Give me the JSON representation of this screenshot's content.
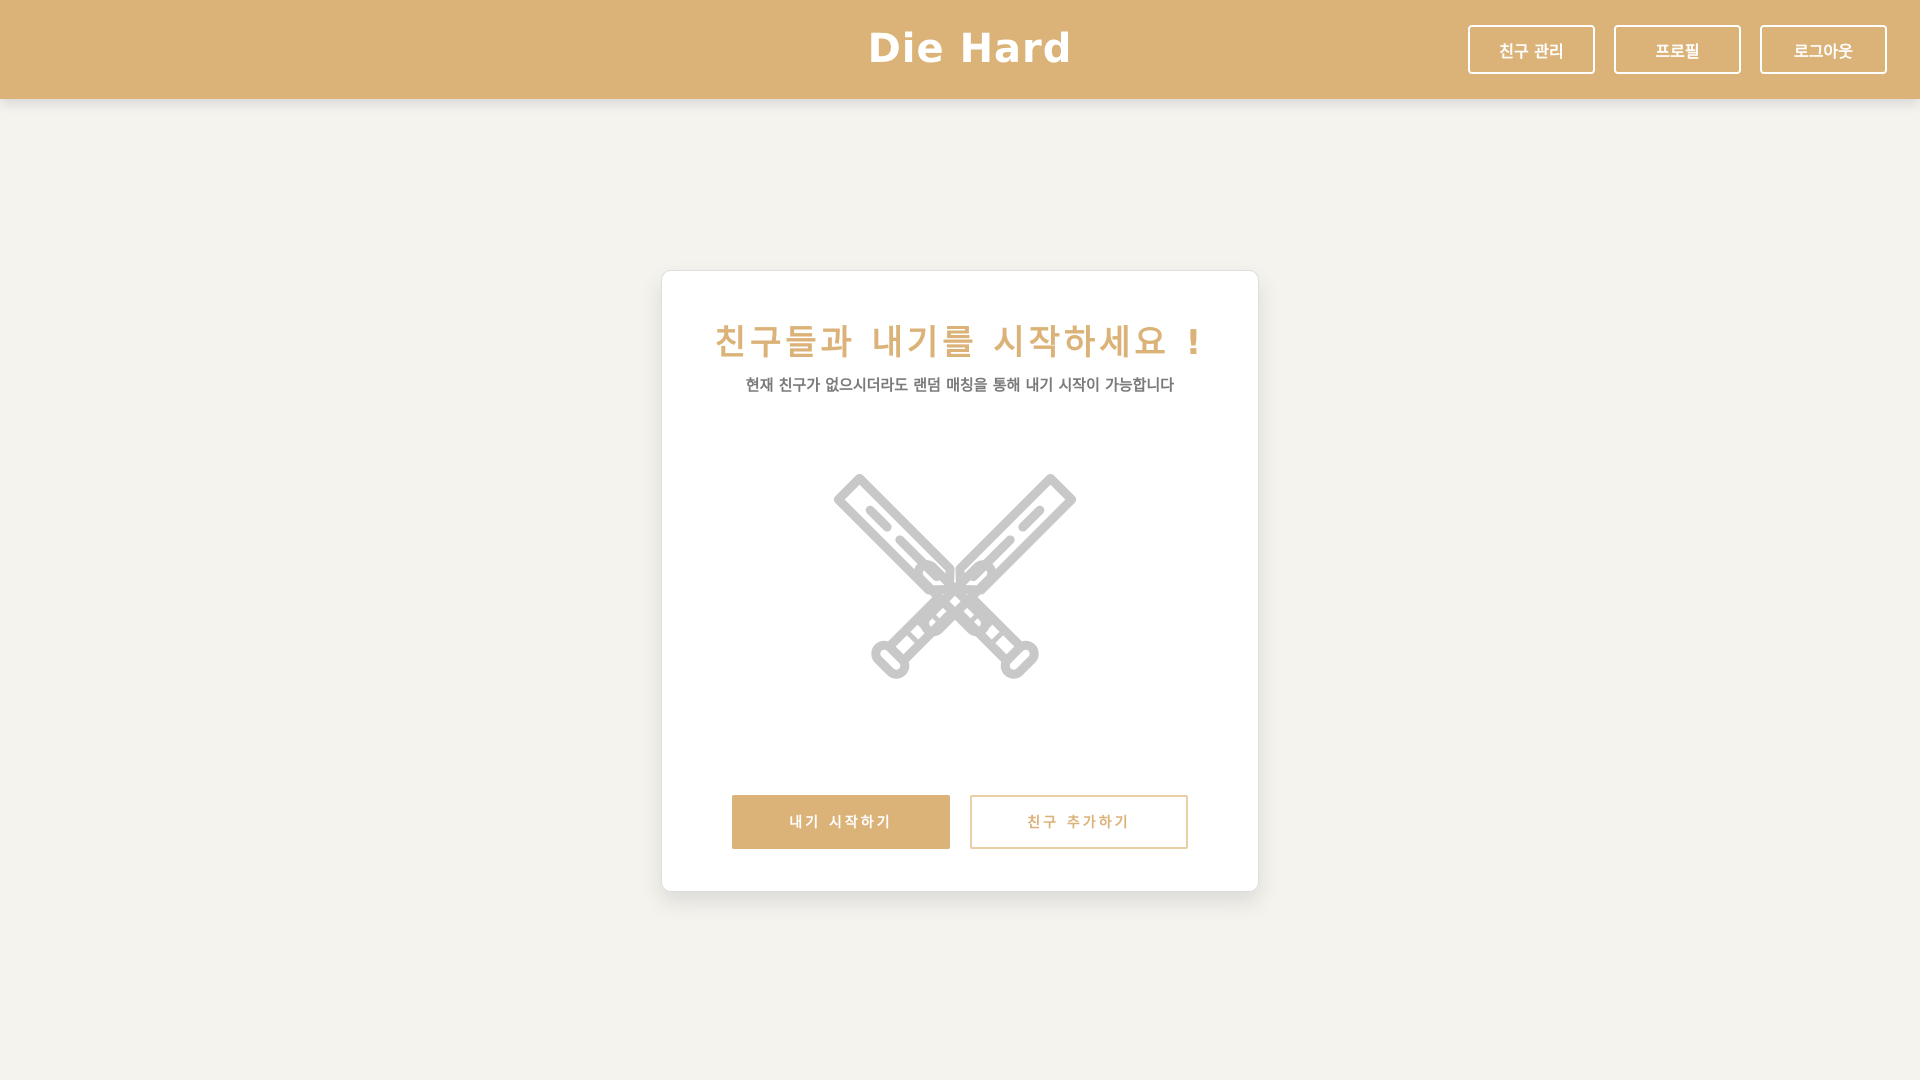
{
  "header": {
    "logo": "Die Hard",
    "nav": {
      "friends_label": "친구 관리",
      "profile_label": "프로필",
      "logout_label": "로그아웃"
    }
  },
  "main": {
    "title": "친구들과 내기를 시작하세요 !",
    "subtitle": "현재 친구가 없으시더라도 랜덤 매칭을 통해 내기 시작이 가능합니다",
    "illustration_icon": "crossed-swords-icon",
    "start_button_label": "내기 시작하기",
    "add_friend_button_label": "친구 추가하기"
  },
  "colors": {
    "accent": "#dbb278",
    "background": "#f4f3ee",
    "icon_gray": "#c8c8c8",
    "subtitle_gray": "#7a7a7a"
  }
}
